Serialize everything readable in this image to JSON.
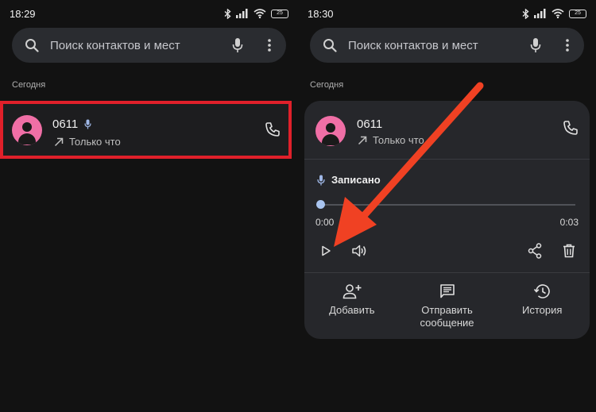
{
  "left_screen": {
    "status": {
      "time": "18:29",
      "battery": "25"
    },
    "search": {
      "placeholder": "Поиск контактов и мест"
    },
    "section": "Сегодня",
    "call": {
      "name": "0611",
      "time": "Только что"
    }
  },
  "right_screen": {
    "status": {
      "time": "18:30",
      "battery": "25"
    },
    "search": {
      "placeholder": "Поиск контактов и мест"
    },
    "section": "Сегодня",
    "call": {
      "name": "0611",
      "time": "Только что"
    },
    "recording": {
      "label": "Записано",
      "position": "0:00",
      "duration": "0:03",
      "progress": 0.0
    },
    "actions": [
      {
        "label": "Добавить",
        "icon": "add-person-icon"
      },
      {
        "label": "Отправить сообщение",
        "icon": "message-icon"
      },
      {
        "label": "История",
        "icon": "history-icon"
      }
    ]
  },
  "colors": {
    "highlight_border": "#e0202a",
    "annotation_arrow": "#f04123",
    "avatar": "#f06fa6",
    "background": "#121212"
  }
}
